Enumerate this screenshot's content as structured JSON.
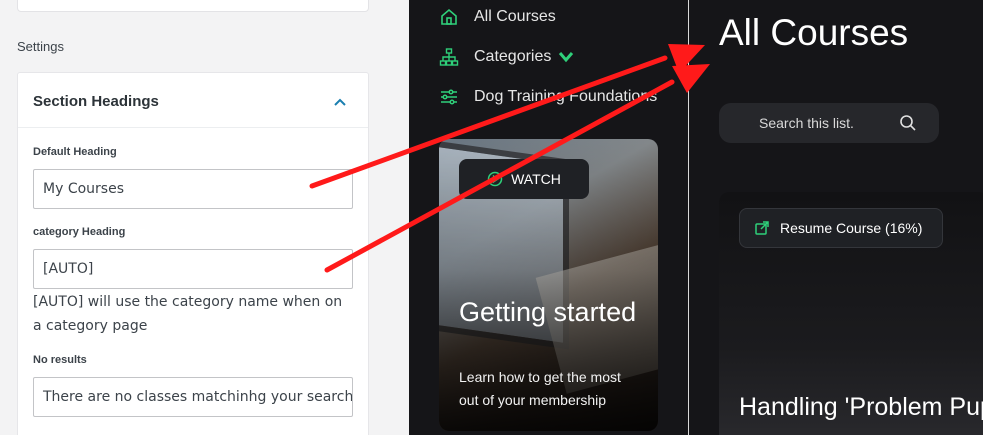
{
  "settings": {
    "section_label": "Settings",
    "card_title": "Section Headings",
    "fields": {
      "default_heading": {
        "label": "Default Heading",
        "value": "My Courses"
      },
      "category_heading": {
        "label": "category Heading",
        "value": "[AUTO]",
        "help": "[AUTO] will use the category name when on a category page"
      },
      "no_results": {
        "label": "No results",
        "value": "There are no classes matchinhg your search. F"
      }
    }
  },
  "preview": {
    "nav": [
      {
        "label": "All Courses",
        "icon": "home-icon"
      },
      {
        "label": "Categories",
        "icon": "sitemap-icon",
        "has_dropdown": true
      },
      {
        "label": "Dog Training Foundations",
        "icon": "sliders-icon"
      }
    ],
    "promo": {
      "watch_label": "WATCH",
      "title": "Getting started",
      "subtitle": "Learn how to get the most out of your membership"
    },
    "page_title": "All Courses",
    "search_placeholder": "Search this list.",
    "course": {
      "resume_label": "Resume Course (16%)",
      "title": "Handling 'Problem Puppy' ..."
    }
  },
  "colors": {
    "accent": "#2fd07a",
    "arrow": "#ff1a1a",
    "dark_bg": "#151518",
    "settings_chevron": "#1a7fb0"
  }
}
